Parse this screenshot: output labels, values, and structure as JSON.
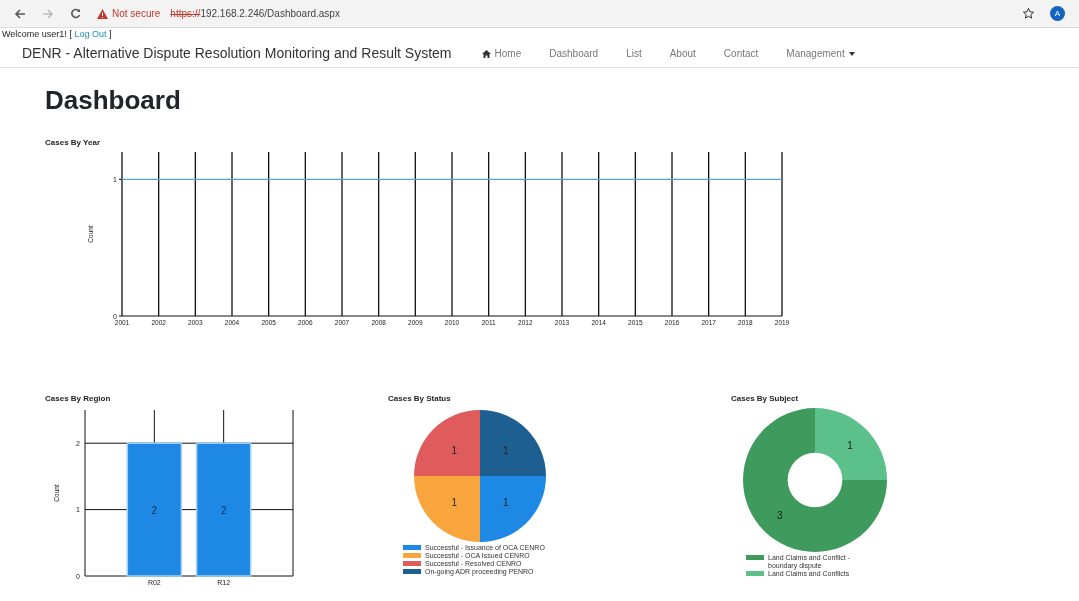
{
  "browser": {
    "security": "Not secure",
    "url_scheme": "https://",
    "url_rest": "192.168.2.246/Dashboard.aspx",
    "avatar": "A"
  },
  "welcome": {
    "text": "Welcome user1!",
    "open": "[",
    "link": "Log Out",
    "close": "]"
  },
  "navbar": {
    "brand": "DENR - Alternative Dispute Resolution Monitoring and Result System",
    "items": [
      {
        "label": "Home",
        "kind": "home"
      },
      {
        "label": "Dashboard",
        "kind": "plain"
      },
      {
        "label": "List",
        "kind": "plain"
      },
      {
        "label": "About",
        "kind": "plain"
      },
      {
        "label": "Contact",
        "kind": "plain"
      },
      {
        "label": "Management",
        "kind": "dropdown"
      }
    ]
  },
  "heading": "Dashboard",
  "year_chart": {
    "chart_data": {
      "type": "line",
      "title": "Cases By Year",
      "ylabel": "Count",
      "x": [
        "2001",
        "2002",
        "2003",
        "2004",
        "2005",
        "2006",
        "2007",
        "2008",
        "2009",
        "2010",
        "2011",
        "2012",
        "2013",
        "2014",
        "2015",
        "2016",
        "2017",
        "2018",
        "2019"
      ],
      "ylim": [
        0,
        1.2
      ],
      "yticks": [
        0,
        1
      ],
      "grid": true,
      "series": [
        {
          "color": "#5ba3d6",
          "values": [
            1,
            1,
            1,
            1,
            1,
            1,
            1,
            1,
            1,
            1,
            1,
            1,
            1,
            1,
            1,
            1,
            1,
            1,
            1
          ]
        }
      ]
    }
  },
  "region_chart": {
    "chart_data": {
      "type": "bar",
      "title": "Cases By Region",
      "ylabel": "Count",
      "categories": [
        "R02",
        "R12"
      ],
      "ylim": [
        0,
        2.5
      ],
      "yticks": [
        0,
        1,
        2
      ],
      "grid": true,
      "data_labels": true,
      "series": [
        {
          "color": "#1e88e5",
          "values": [
            2,
            2
          ]
        }
      ]
    }
  },
  "status_chart": {
    "chart_data": {
      "type": "pie",
      "title": "Cases By Status",
      "categories": [
        "Successful - Issuance of OCA CENRO",
        "Successful - OCA Issued CENRO",
        "Successful - Resolved CENRO",
        "On-going ADR proceeding PENRO"
      ],
      "values": [
        1,
        1,
        1,
        1
      ],
      "colors": [
        "#1e88e5",
        "#f9a53e",
        "#e05c5c",
        "#1d5f91"
      ],
      "data_labels": true,
      "legend": "bottom"
    }
  },
  "subject_chart": {
    "chart_data": {
      "type": "donut",
      "title": "Cases By Subject",
      "categories": [
        "Land Claims and Conflict - boundary dispute",
        "Land Claims and Conflicts"
      ],
      "values": [
        3,
        1
      ],
      "colors": [
        "#3f9a5e",
        "#5cc08a"
      ],
      "data_labels": true,
      "legend": "bottom"
    }
  }
}
